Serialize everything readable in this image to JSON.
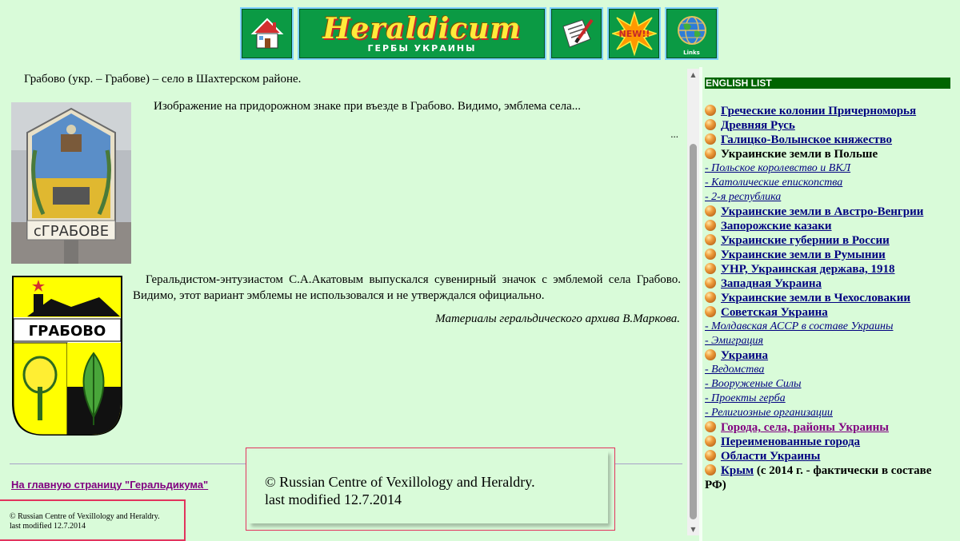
{
  "banner": {
    "logo_title": "Heraldicum",
    "logo_subtitle": "ГЕРБЫ УКРАИНЫ",
    "links_label": "Links",
    "new_label": "NEW!!",
    "icons": [
      "home-icon",
      "guestbook-icon",
      "new-icon",
      "globe-icon"
    ]
  },
  "content": {
    "intro": "Грабово (укр. – Грабове) – село в Шахтерском районе.",
    "photo_caption": "Изображение на придорожном знаке при въезде в Грабово. Видимо, эмблема села...",
    "photo_sign_text": "сГРАБОВЕ",
    "ellipsis": "...",
    "emblem_label": "ГРАБОВО",
    "emblem_caption": "Геральдистом-энтузиастом С.А.Акатовым выпускался сувенирный значок с эмблемой села Грабово. Видимо, этот вариант эмблемы не использовался и не утверждался официально.",
    "source": "Материалы геральдического архива В.Маркова."
  },
  "footer": {
    "home_link": "На главную страницу \"Геральдикума\"",
    "copyright": "© Russian Centre of Vexillology and Heraldry.",
    "modified": "last modified 12.7.2014"
  },
  "sidebar": {
    "english_list": "ENGLISH LIST",
    "items": [
      {
        "label": "Греческие колонии Причерноморья",
        "kind": "main",
        "link": true
      },
      {
        "label": "Древняя Русь",
        "kind": "main",
        "link": true
      },
      {
        "label": "Галицко-Волынское княжество",
        "kind": "main",
        "link": true
      },
      {
        "label": "Украинские земли в Польше",
        "kind": "main",
        "link": false
      },
      {
        "label": "- Польское королевство и ВКЛ",
        "kind": "sub",
        "link": true
      },
      {
        "label": "- Католические епископства",
        "kind": "sub",
        "link": true
      },
      {
        "label": "- 2-я республика",
        "kind": "sub",
        "link": true
      },
      {
        "label": "Украинские земли в Австро-Венгрии",
        "kind": "main",
        "link": true
      },
      {
        "label": "Запорожские казаки",
        "kind": "main",
        "link": true
      },
      {
        "label": "Украинские губернии в России",
        "kind": "main",
        "link": true
      },
      {
        "label": "Украинские земли в Румынии",
        "kind": "main",
        "link": true
      },
      {
        "label": "УНР, Украинская держава, 1918",
        "kind": "main",
        "link": true
      },
      {
        "label": "Западная Украина",
        "kind": "main",
        "link": true
      },
      {
        "label": "Украинские земли в Чехословакии",
        "kind": "main",
        "link": true
      },
      {
        "label": "Советская Украина",
        "kind": "main",
        "link": true
      },
      {
        "label": "- Молдавская АССР в составе Украины",
        "kind": "sub",
        "link": true
      },
      {
        "label": "- Эмиграция",
        "kind": "sub",
        "link": true
      },
      {
        "label": "Украина",
        "kind": "main",
        "link": true
      },
      {
        "label": "- Ведомства",
        "kind": "sub",
        "link": true
      },
      {
        "label": "- Вооруженые Силы",
        "kind": "sub",
        "link": true
      },
      {
        "label": "- Проекты герба",
        "kind": "sub",
        "link": true
      },
      {
        "label": "- Религиозные организации",
        "kind": "sub",
        "link": true
      },
      {
        "label": "Города, села, районы Украины",
        "kind": "main",
        "link": true,
        "visited": true
      },
      {
        "label": "Переименованные города",
        "kind": "main",
        "link": true
      },
      {
        "label": "Области Украины",
        "kind": "main",
        "link": true
      }
    ],
    "crimea": {
      "label": "Крым",
      "note": " (с 2014 г. - фактически в составе РФ)"
    }
  },
  "colors": {
    "page_bg": "#d9fbd9",
    "banner_green": "#0b9a44",
    "english_bar": "#006400",
    "link": "#000080",
    "visited": "#800080",
    "highlight_border": "#e2335d"
  }
}
